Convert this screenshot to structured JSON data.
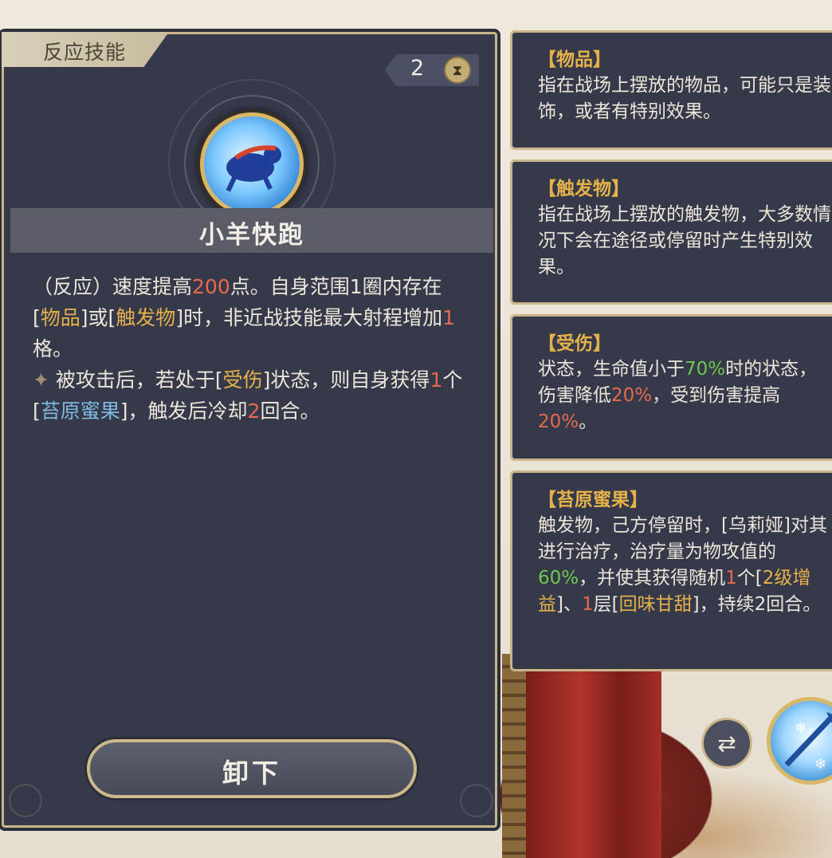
{
  "panel": {
    "category_tag": "反应技能",
    "cost": "2",
    "skill_name": "小羊快跑",
    "description": {
      "p1_a": "（反应）速度提高",
      "p1_num1": "200",
      "p1_b": "点。自身范围1圈内存在[",
      "p1_kw1": "物品",
      "p1_c": "]或[",
      "p1_kw2": "触发物",
      "p1_d": "]时，非近战技能最大射程增加",
      "p1_num2": "1",
      "p1_e": "格。",
      "p2_bullet": "✦",
      "p2_a": " 被攻击后，若处于[",
      "p2_kw1": "受伤",
      "p2_b": "]状态，则自身获得",
      "p2_num1": "1",
      "p2_c": "个[",
      "p2_kw2": "苔原蜜果",
      "p2_d": "]，触发后冷却",
      "p2_num2": "2",
      "p2_e": "回合。"
    },
    "unload_button": "卸下"
  },
  "glossary": {
    "item": {
      "title": "【物品】",
      "body": "指在战场上摆放的物品，可能只是装饰，或者有特别效果。"
    },
    "trigger": {
      "title": "【触发物】",
      "body": "指在战场上摆放的触发物，大多数情况下会在途径或停留时产生特别效果。"
    },
    "injured": {
      "title": "【受伤】",
      "a": "状态，生命值小于",
      "v1": "70%",
      "b": "时的状态，伤害降低",
      "v2": "20%",
      "c": "，受到伤害提高",
      "v3": "20%",
      "d": "。"
    },
    "berry": {
      "title": "【苔原蜜果】",
      "a": "触发物，己方停留时，[乌莉娅]对其进行治疗，治疗量为物攻值的",
      "v1": "60%",
      "b": "，并使其获得随机",
      "v2": "1",
      "c": "个[",
      "k1": "2级增益",
      "d": "]、",
      "v3": "1",
      "e": "层[",
      "k2": "回味甘甜",
      "f": "]，持续2回合。"
    }
  },
  "colors": {
    "panel_bg": "#353949",
    "gold_border": "#c9b48c",
    "keyword": "#e5b24a",
    "number": "#e8694e",
    "green_value": "#6ec84e",
    "blue_keyword": "#7fb8e0"
  },
  "icons": {
    "cost": "hourglass-icon",
    "skill": "running-sheep-icon",
    "swap": "swap-arrows-icon",
    "slot": "ice-spear-skill-icon"
  }
}
